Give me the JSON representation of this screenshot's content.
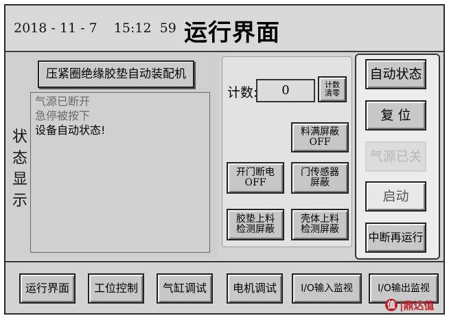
{
  "header": {
    "date": "2018 - 11 - 7",
    "time": "15:12  59",
    "title": "运行界面"
  },
  "machine_name": "压紧圈绝缘胶垫自动装配机",
  "status": {
    "label_chars": [
      "状",
      "态",
      "显",
      "示"
    ],
    "lines": [
      {
        "text": "气源已断开",
        "color": "#6a6a6a"
      },
      {
        "text": "急停被按下",
        "color": "#6a6a6a"
      },
      {
        "text": "设备自动状态!",
        "color": "#000000"
      }
    ]
  },
  "counter": {
    "label": "计数:",
    "value": "0",
    "clear_line1": "计数",
    "clear_line2": "清零"
  },
  "toggles": {
    "material_full": {
      "label": "料满屏蔽",
      "state": "OFF"
    },
    "door_open": {
      "label": "开门断电",
      "state": "OFF"
    },
    "door_sensor": {
      "line1": "门传感器",
      "line2": "屏蔽"
    },
    "pad_feed": {
      "line1": "胶垫上料",
      "line2": "检测屏蔽"
    },
    "shell_feed": {
      "line1": "壳体上料",
      "line2": "检测屏蔽"
    }
  },
  "right_buttons": {
    "auto_state": "自动状态",
    "reset": "复 位",
    "air_off": "气源已关",
    "start": "启动",
    "resume": "中断再运行"
  },
  "nav": {
    "run": "运行界面",
    "station": "工位控制",
    "cylinder": "气缸调试",
    "motor": "电机调试",
    "io_in": "I/O输入监视",
    "io_out": "I/O输出监视"
  },
  "watermark": {
    "icon_char": "值",
    "text": "|鼎达值"
  },
  "colors": {
    "panel_bg": "#d4d4d4",
    "button_bg": "#c6c6c6",
    "disabled_text": "#b6b6b6",
    "watermark_red": "#c0202a"
  }
}
